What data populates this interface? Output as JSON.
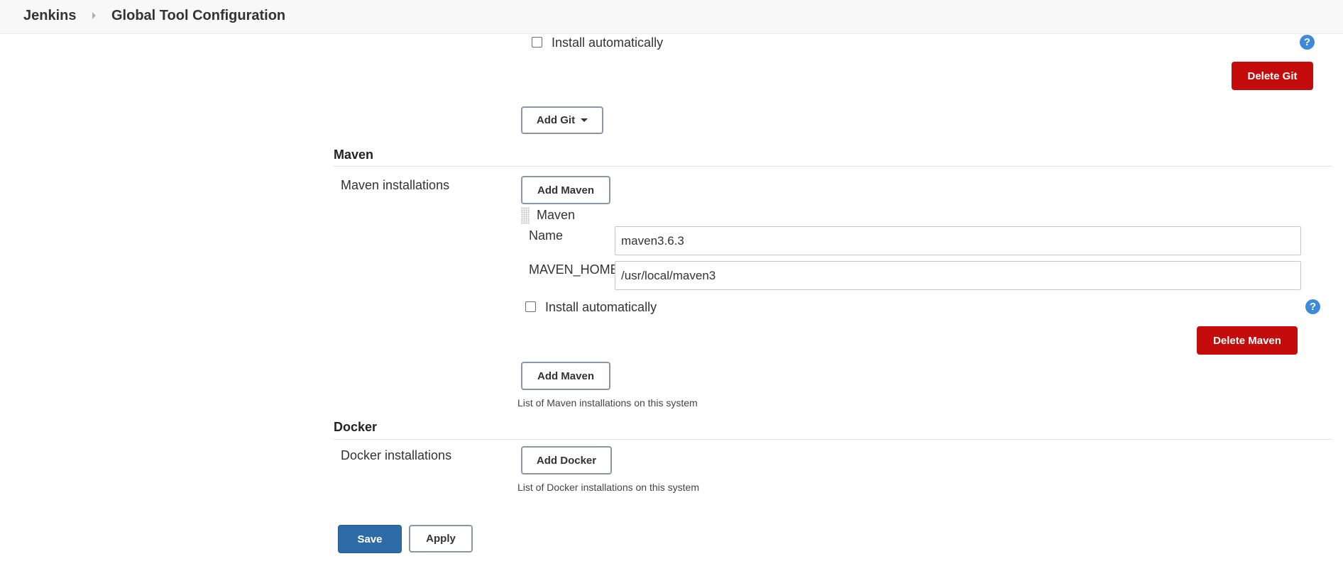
{
  "breadcrumb": {
    "root": "Jenkins",
    "current": "Global Tool Configuration"
  },
  "git": {
    "install_auto_label": "Install automatically",
    "delete_label": "Delete Git",
    "add_label": "Add Git",
    "help_icon": "?"
  },
  "maven": {
    "section_title": "Maven",
    "installations_label": "Maven installations",
    "add_label_top": "Add Maven",
    "item_title": "Maven",
    "name_label": "Name",
    "name_value": "maven3.6.3",
    "home_label": "MAVEN_HOME",
    "home_value": "/usr/local/maven3",
    "install_auto_label": "Install automatically",
    "help_icon": "?",
    "delete_label": "Delete Maven",
    "add_label_bottom": "Add Maven",
    "help_text": "List of Maven installations on this system"
  },
  "docker": {
    "section_title": "Docker",
    "installations_label": "Docker installations",
    "add_label": "Add Docker",
    "help_text": "List of Docker installations on this system"
  },
  "footer": {
    "save_label": "Save",
    "apply_label": "Apply"
  },
  "colors": {
    "danger": "#c50c0c",
    "primary": "#2f6ba6",
    "help": "#3d8bd8"
  }
}
